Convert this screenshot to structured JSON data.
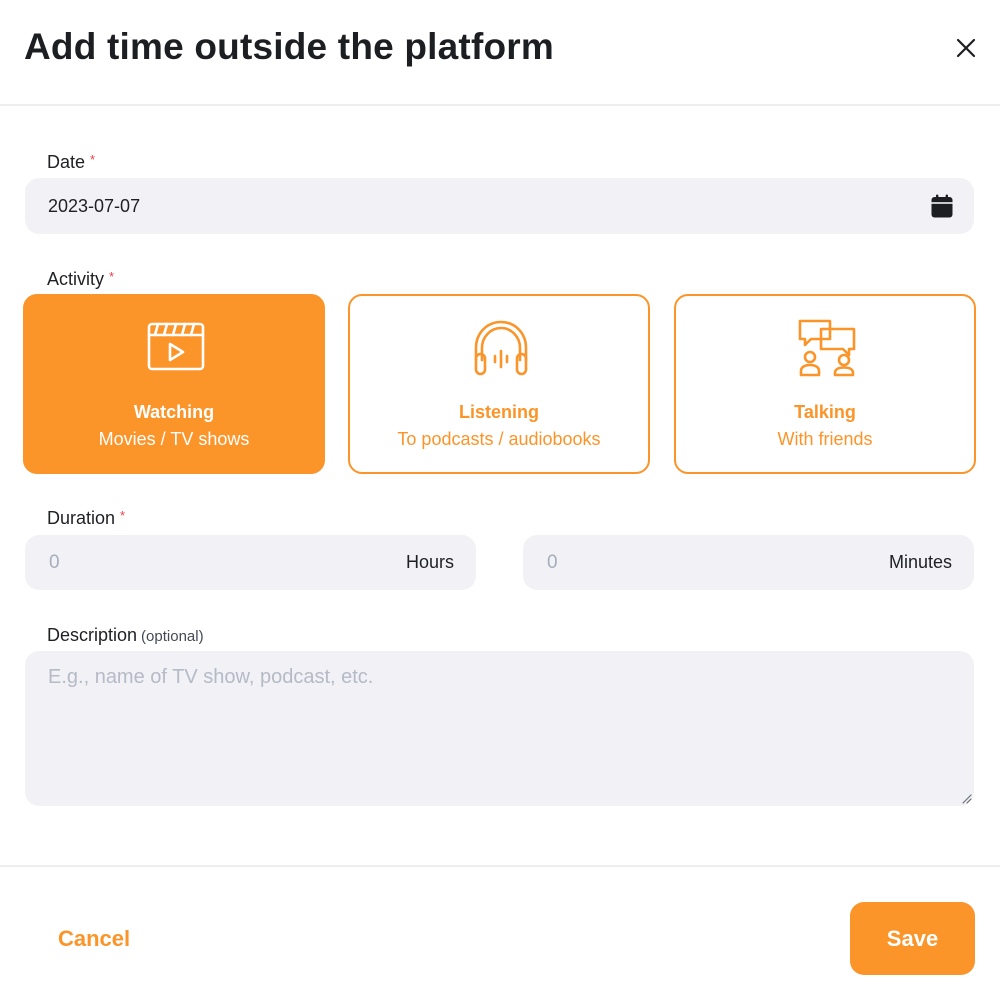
{
  "dialog": {
    "title": "Add time outside the platform"
  },
  "colors": {
    "accent": "#fb9429",
    "field_bg": "#f2f2f6",
    "required": "#ee3d48",
    "placeholder": "#b4bac6"
  },
  "date": {
    "label": "Date",
    "required_mark": "*",
    "value": "2023-07-07",
    "icon": "calendar-icon"
  },
  "activity": {
    "label": "Activity",
    "required_mark": "*",
    "options": [
      {
        "title": "Watching",
        "subtitle": "Movies / TV shows",
        "icon": "clapperboard-play-icon",
        "selected": true
      },
      {
        "title": "Listening",
        "subtitle": "To podcasts / audiobooks",
        "icon": "headphones-icon",
        "selected": false
      },
      {
        "title": "Talking",
        "subtitle": "With friends",
        "icon": "chat-people-icon",
        "selected": false
      }
    ]
  },
  "duration": {
    "label": "Duration",
    "required_mark": "*",
    "hours": {
      "placeholder": "0",
      "unit": "Hours"
    },
    "minutes": {
      "placeholder": "0",
      "unit": "Minutes"
    }
  },
  "description": {
    "label": "Description",
    "optional_note": "(optional)",
    "placeholder": "E.g., name of TV show, podcast, etc."
  },
  "footer": {
    "cancel_label": "Cancel",
    "save_label": "Save"
  }
}
